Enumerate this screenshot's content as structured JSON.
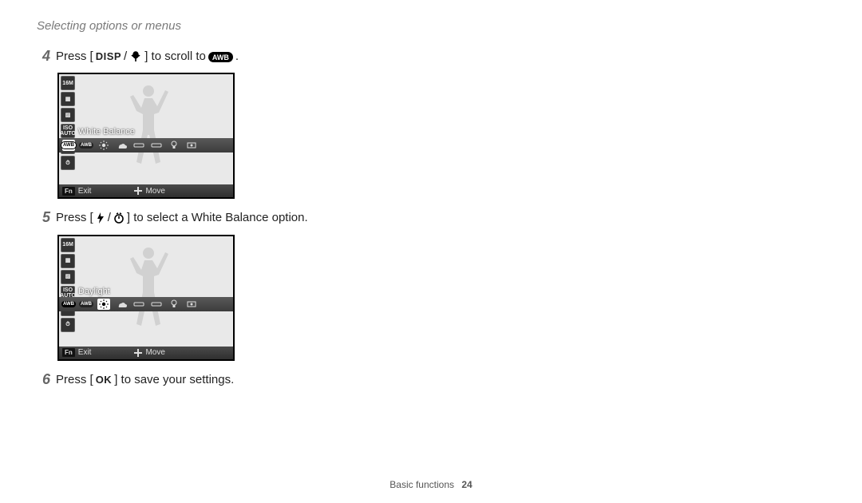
{
  "header": {
    "section_title": "Selecting options or menus"
  },
  "steps": {
    "s4": {
      "num": "4",
      "pre": "Press [",
      "mid": "] to scroll to ",
      "post": "."
    },
    "s5": {
      "num": "5",
      "pre": "Press [",
      "post": "] to select a White Balance option."
    },
    "s6": {
      "num": "6",
      "pre": "Press [",
      "ok": "OK",
      "post": "] to save your settings."
    }
  },
  "buttons": {
    "disp": "DISP",
    "awb_chip": "AWB"
  },
  "lcd1": {
    "label": "White Balance",
    "fn": "Fn",
    "exit": "Exit",
    "move": "Move"
  },
  "lcd2": {
    "label": "Daylight",
    "fn": "Fn",
    "exit": "Exit",
    "move": "Move"
  },
  "footer": {
    "section": "Basic functions",
    "page": "24"
  }
}
